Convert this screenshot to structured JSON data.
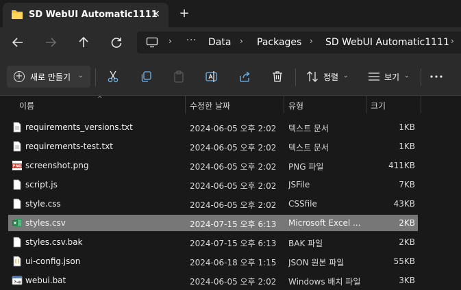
{
  "tab": {
    "title": "SD WebUI Automatic1111",
    "close_glyph": "✕",
    "new_tab_glyph": "+"
  },
  "address": {
    "ellipsis": "···",
    "separator": "›",
    "crumbs": [
      "Data",
      "Packages",
      "SD WebUI Automatic1111"
    ]
  },
  "commands": {
    "new_label": "새로 만들기",
    "sort_label": "정렬",
    "view_label": "보기",
    "chevron": "⌄"
  },
  "columns": {
    "name": "이름",
    "date": "수정한 날짜",
    "type": "유형",
    "size": "크기",
    "sort_indicator": "^"
  },
  "files": [
    {
      "name": "requirements_versions.txt",
      "date": "2024-06-05 오후 2:02",
      "type": "텍스트 문서",
      "size": "1KB",
      "icon": "text-file-icon"
    },
    {
      "name": "requirements-test.txt",
      "date": "2024-06-05 오후 2:02",
      "type": "텍스트 문서",
      "size": "1KB",
      "icon": "text-file-icon"
    },
    {
      "name": "screenshot.png",
      "date": "2024-06-05 오후 2:02",
      "type": "PNG 파일",
      "size": "411KB",
      "icon": "png-file-icon"
    },
    {
      "name": "script.js",
      "date": "2024-06-05 오후 2:02",
      "type": "JSFile",
      "size": "7KB",
      "icon": "blank-file-icon"
    },
    {
      "name": "style.css",
      "date": "2024-06-05 오후 2:02",
      "type": "CSSfile",
      "size": "43KB",
      "icon": "blank-file-icon"
    },
    {
      "name": "styles.csv",
      "date": "2024-07-15 오후 6:13",
      "type": "Microsoft Excel ...",
      "size": "2KB",
      "icon": "excel-file-icon",
      "selected": true
    },
    {
      "name": "styles.csv.bak",
      "date": "2024-07-15 오후 6:13",
      "type": "BAK 파일",
      "size": "2KB",
      "icon": "blank-file-icon"
    },
    {
      "name": "ui-config.json",
      "date": "2024-06-18 오후 1:15",
      "type": "JSON 원본 파일",
      "size": "55KB",
      "icon": "json-file-icon"
    },
    {
      "name": "webui.bat",
      "date": "2024-06-05 오후 2:02",
      "type": "Windows 배치 파일",
      "size": "3KB",
      "icon": "batch-file-icon"
    }
  ],
  "colors": {
    "window_bg": "#191919",
    "bar_bg": "#2b2b2b",
    "selected_row": "#777777",
    "folder": "#f5c542",
    "excel": "#1f7a45"
  }
}
